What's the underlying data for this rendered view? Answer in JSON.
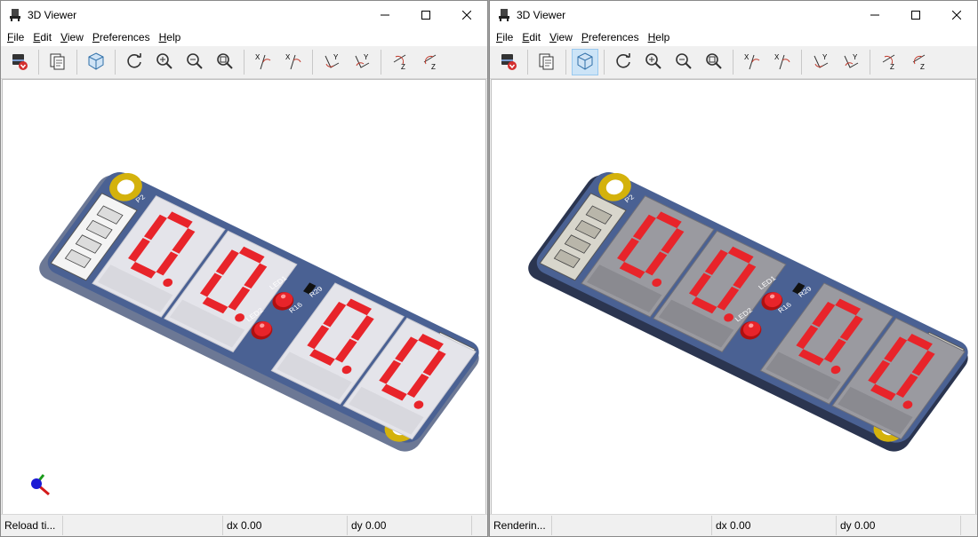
{
  "left_window": {
    "title": "3D Viewer",
    "menu": [
      {
        "first": "F",
        "rest": "ile"
      },
      {
        "first": "E",
        "rest": "dit"
      },
      {
        "first": "V",
        "rest": "iew"
      },
      {
        "first": "P",
        "rest": "references"
      },
      {
        "first": "H",
        "rest": "elp"
      }
    ],
    "status": {
      "message": "Reload ti...",
      "dx": "dx 0.00",
      "dy": "dy 0.00"
    }
  },
  "right_window": {
    "title": "3D Viewer",
    "menu": [
      {
        "first": "F",
        "rest": "ile"
      },
      {
        "first": "E",
        "rest": "dit"
      },
      {
        "first": "V",
        "rest": "iew"
      },
      {
        "first": "P",
        "rest": "references"
      },
      {
        "first": "H",
        "rest": "elp"
      }
    ],
    "status": {
      "message": "Renderin...",
      "dx": "dx 0.00",
      "dy": "dy 0.00"
    }
  },
  "toolbar_icons": [
    "export-icon",
    "copy-icon",
    "raytracing-cube-icon",
    "reload-icon",
    "zoom-in-icon",
    "zoom-out-icon",
    "zoom-fit-icon",
    "rotate-x-cw-icon",
    "rotate-x-ccw-icon",
    "rotate-y-cw-icon",
    "rotate-y-ccw-icon",
    "rotate-z-cw-icon",
    "rotate-z-ccw-icon"
  ],
  "board": {
    "labels": {
      "led1": "LED1",
      "led2": "LED2",
      "r9": "R29",
      "r16": "R16",
      "p": "P2"
    },
    "colors": {
      "pcb": "#4a6193",
      "segment": "#e8242a",
      "housing": "#e4e4ea",
      "housing_rt": "#9a9aa0",
      "pad": "#d4b20c"
    }
  }
}
